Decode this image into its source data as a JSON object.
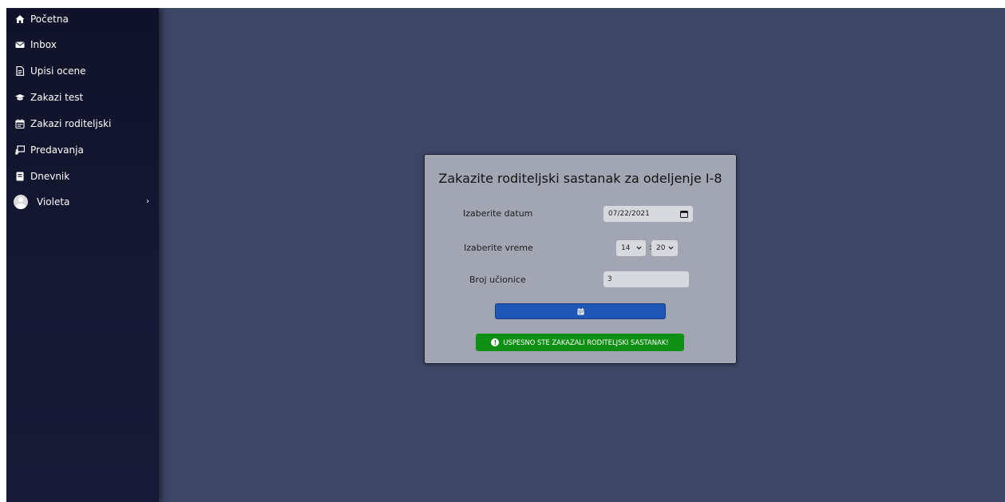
{
  "sidebar": {
    "items": [
      {
        "label": "Početna",
        "icon": "home-icon"
      },
      {
        "label": "Inbox",
        "icon": "envelope-icon"
      },
      {
        "label": "Upisi ocene",
        "icon": "document-icon"
      },
      {
        "label": "Zakazi test",
        "icon": "graduation-cap-icon"
      },
      {
        "label": "Zakazi roditeljski",
        "icon": "calendar-icon"
      },
      {
        "label": "Predavanja",
        "icon": "chalkboard-icon"
      },
      {
        "label": "Dnevnik",
        "icon": "book-icon"
      }
    ],
    "user": {
      "name": "Violeta",
      "icon": "avatar-icon",
      "chevron": "›"
    }
  },
  "form": {
    "title": "Zakazite roditeljski sastanak za odeljenje I-8",
    "date_label": "Izaberite datum",
    "date_value": "07/22/2021",
    "time_label": "Izaberite vreme",
    "hour_value": "14",
    "minute_value": "20",
    "time_separator": ":",
    "room_label": "Broj učionice",
    "room_value": "3",
    "submit_icon": "calendar-icon",
    "success_message": "USPESNO STE ZAKAZALI RODITELJSKI SASTANAK!",
    "success_icon": "exclamation-circle-icon"
  },
  "colors": {
    "background": "#3c4665",
    "sidebar": "#141833",
    "card": "#a2a6b3",
    "button": "#1e57b6",
    "success": "#0f8f14"
  }
}
